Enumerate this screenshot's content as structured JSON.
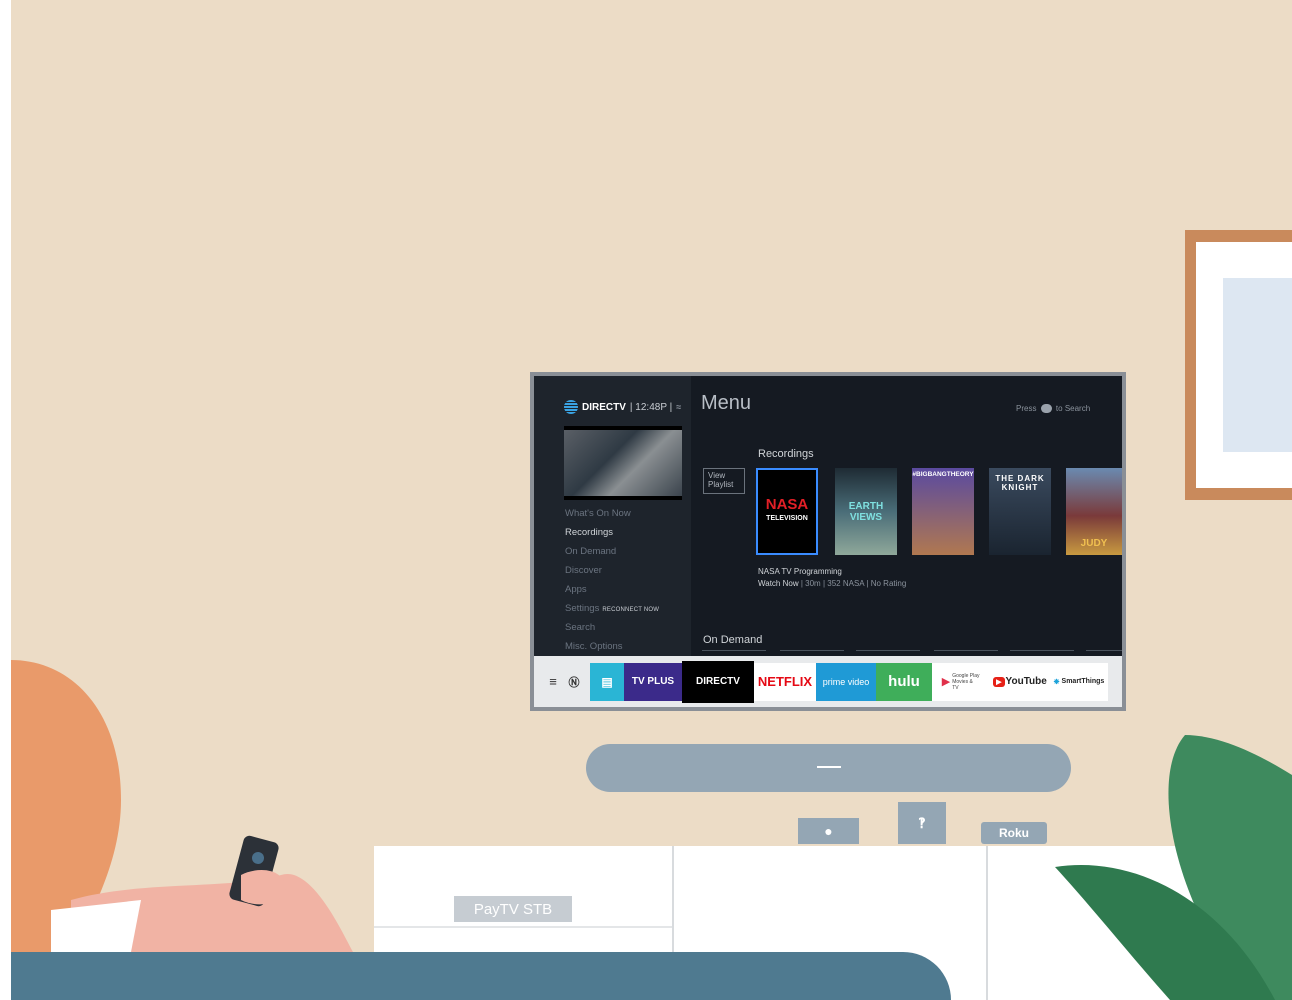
{
  "tv": {
    "logo_text": "DIRECTV",
    "time": "12:48P",
    "menu_heading": "Menu",
    "search_hint_pre": "Press",
    "search_hint_post": "to Search",
    "sidebar": {
      "items": [
        {
          "label": "What's On Now"
        },
        {
          "label": "Recordings"
        },
        {
          "label": "On Demand"
        },
        {
          "label": "Discover"
        },
        {
          "label": "Apps"
        },
        {
          "label": "Settings",
          "badge": "RECONNECT NOW"
        },
        {
          "label": "Search"
        },
        {
          "label": "Misc. Options"
        }
      ],
      "active_index": 1
    },
    "recordings": {
      "title": "Recordings",
      "view_playlist": "View Playlist",
      "cards": [
        {
          "title": "NASA",
          "subtitle": "TELEVISION",
          "color": "#000000"
        },
        {
          "title": "EARTH VIEWS",
          "color": "#4a6d78"
        },
        {
          "title": "#BIGBANGTHEORY",
          "color": "#6a58a8"
        },
        {
          "title": "THE DARK KNIGHT",
          "color": "#2e3b4c"
        },
        {
          "title": "JUDY",
          "color": "#7a3a3a"
        }
      ],
      "selected_title": "NASA TV Programming",
      "selected_meta": {
        "action": "Watch Now",
        "duration": "30m",
        "channel": "352 NASA",
        "rating": "No Rating"
      }
    },
    "on_demand": {
      "title": "On Demand"
    },
    "launcher": {
      "apps": [
        {
          "label": "TV PLUS",
          "bg": "#3b2a8a",
          "fg": "#ffffff"
        },
        {
          "label": "DIRECTV",
          "bg": "#000000",
          "fg": "#ffffff"
        },
        {
          "label": "NETFLIX",
          "bg": "#ffffff",
          "fg": "#e50914"
        },
        {
          "label": "prime video",
          "bg": "#1f9ad6",
          "fg": "#ffffff"
        },
        {
          "label": "hulu",
          "bg": "#3fae5a",
          "fg": "#ffffff"
        },
        {
          "label": "Google Play Movies & TV",
          "bg": "#ffffff",
          "fg": "#444444"
        },
        {
          "label": "YouTube",
          "bg": "#ffffff",
          "fg": "#222222"
        },
        {
          "label": "SmartThings",
          "bg": "#ffffff",
          "fg": "#222222"
        }
      ]
    }
  },
  "devices": {
    "roku_label": "Roku",
    "stb_label": "PayTV STB"
  }
}
